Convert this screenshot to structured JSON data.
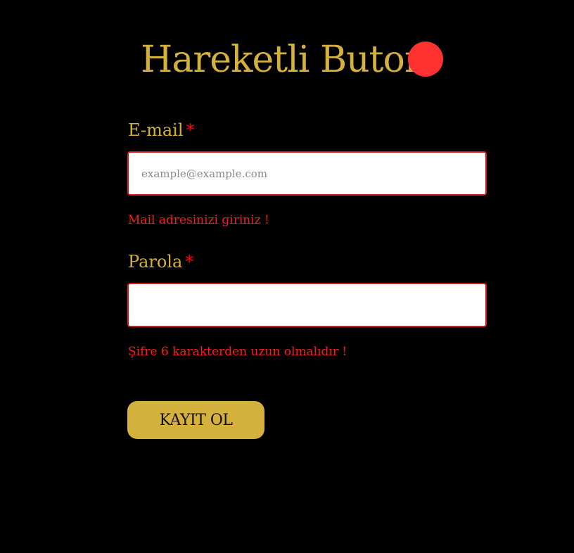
{
  "header": {
    "title": "Hareketli Buton",
    "status_dot_color": "#ff3131"
  },
  "form": {
    "email": {
      "label": "E-mail",
      "required_mark": "*",
      "placeholder": "example@example.com",
      "value": "",
      "error": "Mail adresinizi giriniz !"
    },
    "password": {
      "label": "Parola",
      "required_mark": "*",
      "placeholder": "",
      "value": "",
      "error": "Şifre 6 karakterden uzun olmalıdır !"
    },
    "submit_label": "KAYIT OL"
  },
  "colors": {
    "background": "#000000",
    "accent": "#d4b13d",
    "error": "#ff1a1a"
  }
}
